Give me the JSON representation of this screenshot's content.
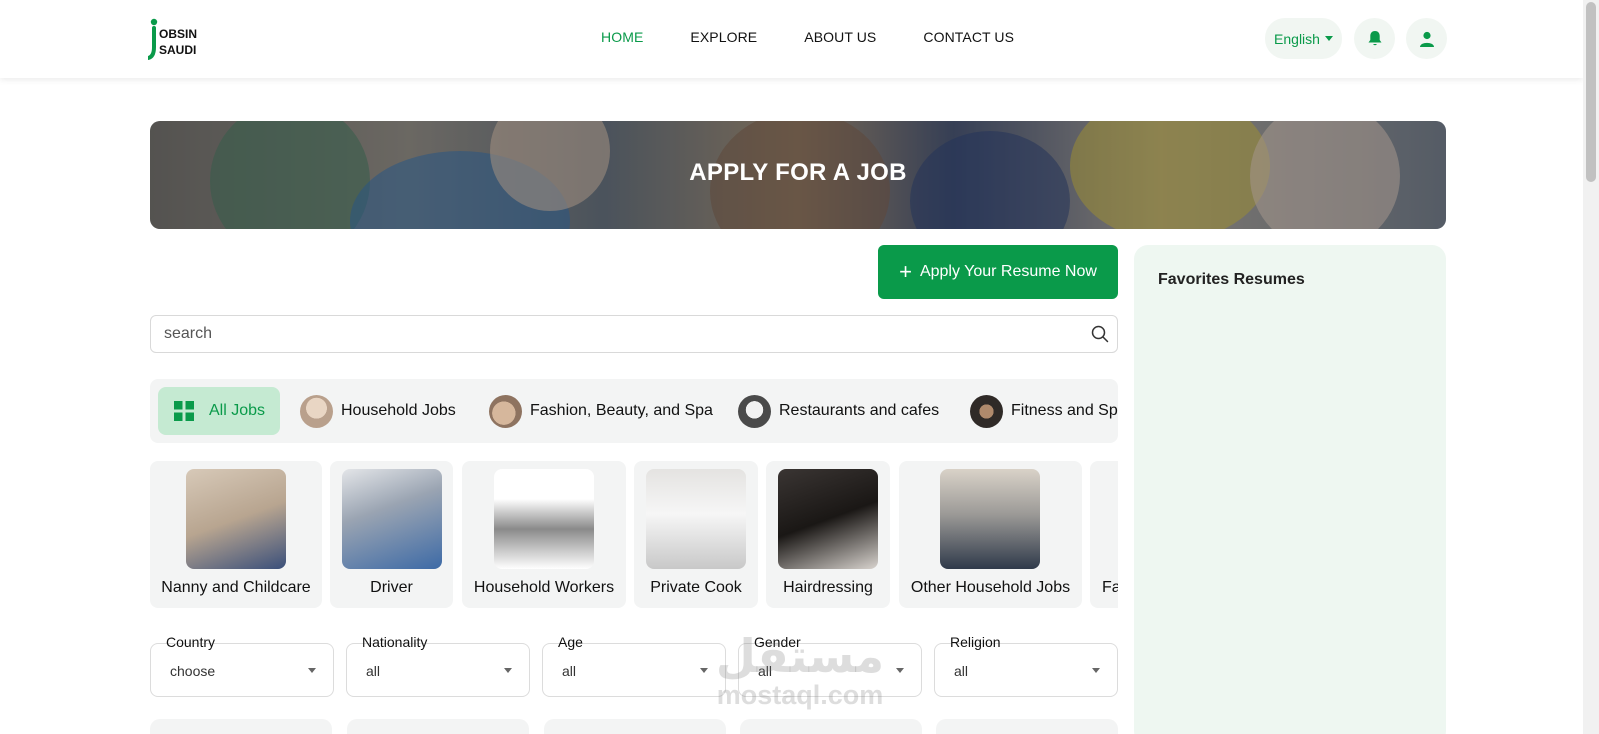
{
  "brand": {
    "logo_line1": "OBSIN",
    "logo_line2": "SAUDI",
    "logo_initial": "J",
    "accent": "#0a9a4a"
  },
  "nav": {
    "items": [
      {
        "label": "HOME",
        "active": true
      },
      {
        "label": "EXPLORE",
        "active": false
      },
      {
        "label": "ABOUT US",
        "active": false
      },
      {
        "label": "CONTACT US",
        "active": false
      }
    ]
  },
  "header_actions": {
    "language": "English",
    "icons": [
      "bell-icon",
      "user-icon"
    ]
  },
  "hero": {
    "title": "APPLY FOR A JOB"
  },
  "apply": {
    "label": "Apply Your Resume Now",
    "icon": "plus-icon"
  },
  "favorites": {
    "title": "Favorites Resumes"
  },
  "search": {
    "placeholder": "search",
    "icon": "search-icon"
  },
  "categories": [
    {
      "label": "All Jobs",
      "icon": "grid-icon",
      "active": true
    },
    {
      "label": "Household Jobs"
    },
    {
      "label": "Fashion, Beauty, and Spa"
    },
    {
      "label": "Restaurants and cafes"
    },
    {
      "label": "Fitness and Sports"
    }
  ],
  "subcategories": [
    {
      "label": "Nanny and Childcare"
    },
    {
      "label": "Driver"
    },
    {
      "label": "Household Workers"
    },
    {
      "label": "Private Cook"
    },
    {
      "label": "Hairdressing"
    },
    {
      "label": "Other Household Jobs"
    },
    {
      "label": "Fa"
    }
  ],
  "filters": [
    {
      "label": "Country",
      "value": "choose"
    },
    {
      "label": "Nationality",
      "value": "all"
    },
    {
      "label": "Age",
      "value": "all"
    },
    {
      "label": "Gender",
      "value": "all"
    },
    {
      "label": "Religion",
      "value": "all"
    }
  ],
  "watermark": {
    "line1": "مستقل",
    "line2": "mostaql.com"
  }
}
